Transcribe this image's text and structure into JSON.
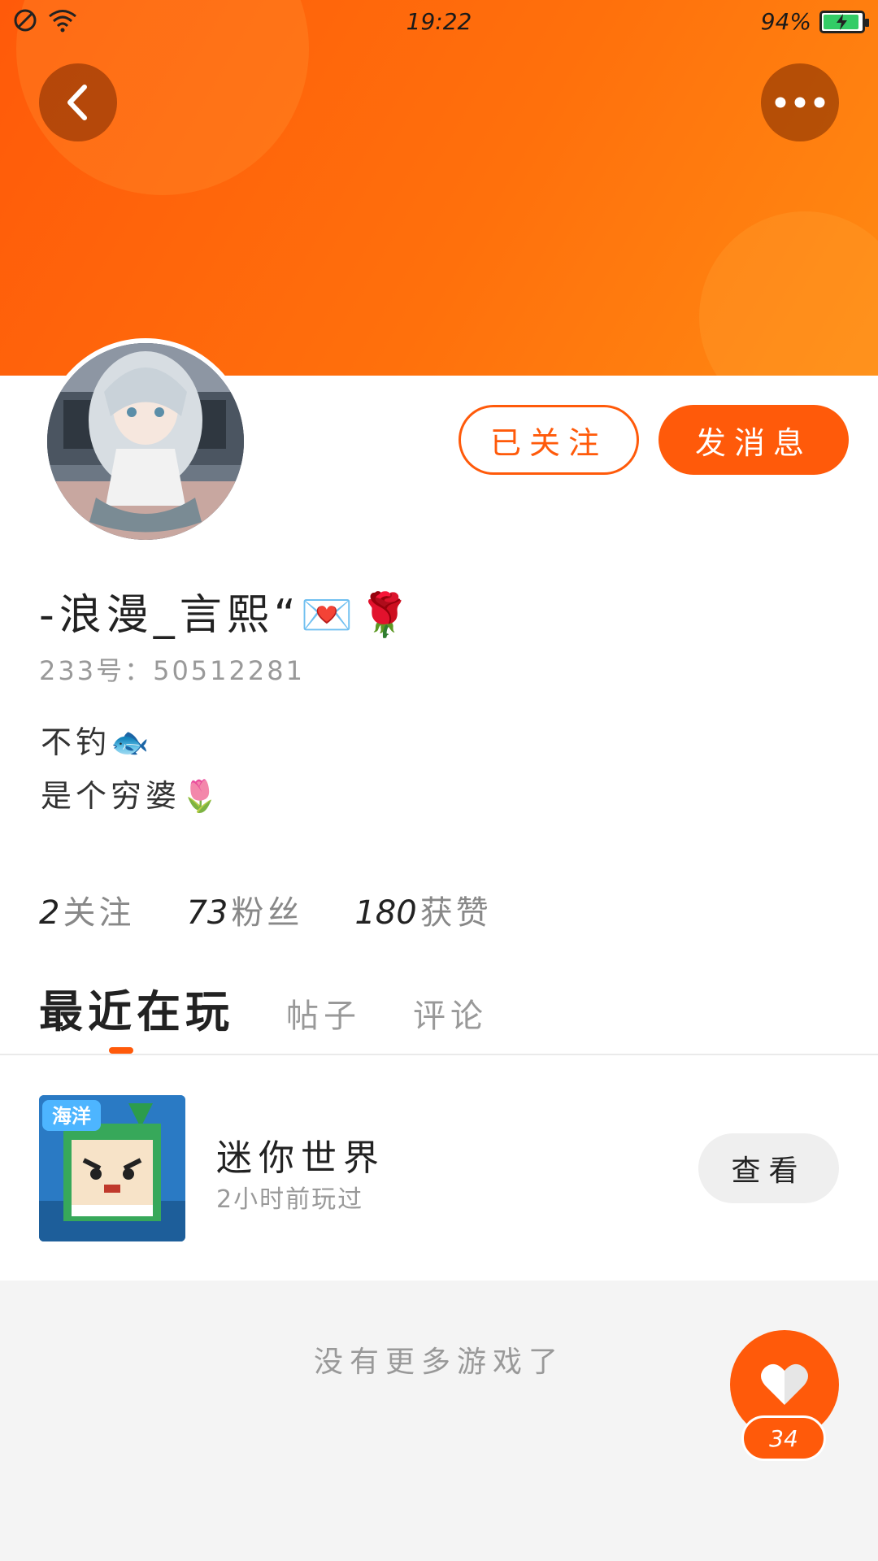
{
  "status_bar": {
    "time": "19:22",
    "battery": "94%",
    "battery_level": 0.94
  },
  "header": {
    "back_icon": "chevron-left-icon",
    "more_icon": "more-horizontal-icon"
  },
  "profile": {
    "username": "-浪漫_言熙“💌🌹",
    "user_id": "233号：50512281",
    "bio_lines": [
      "不钓🐟",
      "是个穷婆🌷"
    ],
    "follow_button": "已关注",
    "message_button": "发消息"
  },
  "stats": [
    {
      "value": "2",
      "label": "关注"
    },
    {
      "value": "73",
      "label": "粉丝"
    },
    {
      "value": "180",
      "label": "获赞"
    }
  ],
  "tabs": [
    {
      "label": "最近在玩",
      "active": true
    },
    {
      "label": "帖子",
      "active": false
    },
    {
      "label": "评论",
      "active": false
    }
  ],
  "games": [
    {
      "name": "迷你世界",
      "played": "2小时前玩过",
      "action": "查看",
      "icon_text": "海洋"
    }
  ],
  "footer": {
    "no_more": "没有更多游戏了"
  },
  "like": {
    "count": "34",
    "icon": "heart-icon"
  },
  "colors": {
    "accent": "#ff5a0a",
    "header_gradient_start": "#ff5a0a",
    "header_gradient_end": "#ff8a12"
  }
}
